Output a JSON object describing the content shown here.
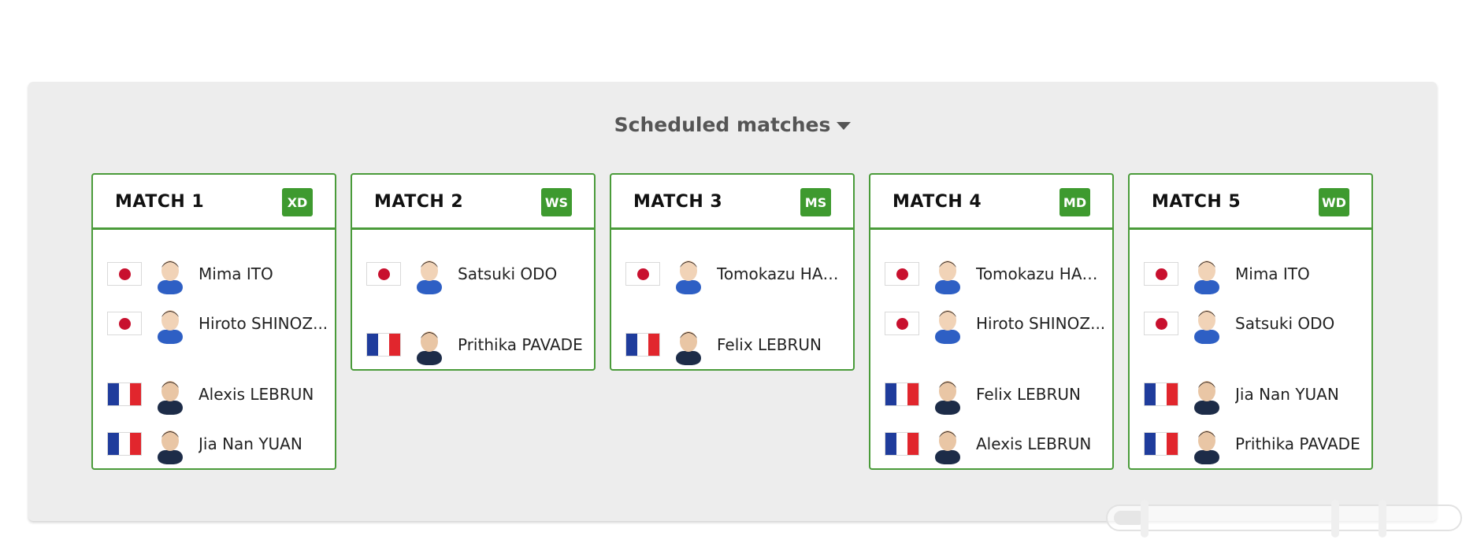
{
  "section": {
    "title": "Scheduled matches"
  },
  "flags": {
    "jp": "japan-flag",
    "fr": "france-flag"
  },
  "colors": {
    "accent_green": "#3e9a2f",
    "card_border": "#4a9b3a",
    "panel_bg": "#ededed"
  },
  "matches": [
    {
      "title": "MATCH 1",
      "badge": "XD",
      "players": [
        {
          "name": "Mima ITO",
          "country": "jp"
        },
        {
          "name": "Hiroto SHINOZ...",
          "country": "jp"
        },
        {
          "name": "Alexis LEBRUN",
          "country": "fr"
        },
        {
          "name": "Jia Nan YUAN",
          "country": "fr"
        }
      ]
    },
    {
      "title": "MATCH 2",
      "badge": "WS",
      "players": [
        {
          "name": "Satsuki ODO",
          "country": "jp"
        },
        {
          "name": "Prithika PAVADE",
          "country": "fr"
        }
      ]
    },
    {
      "title": "MATCH 3",
      "badge": "MS",
      "players": [
        {
          "name": "Tomokazu HARI...",
          "country": "jp"
        },
        {
          "name": "Felix LEBRUN",
          "country": "fr"
        }
      ]
    },
    {
      "title": "MATCH 4",
      "badge": "MD",
      "players": [
        {
          "name": "Tomokazu HARI...",
          "country": "jp"
        },
        {
          "name": "Hiroto SHINOZ...",
          "country": "jp"
        },
        {
          "name": "Felix LEBRUN",
          "country": "fr"
        },
        {
          "name": "Alexis LEBRUN",
          "country": "fr"
        }
      ]
    },
    {
      "title": "MATCH 5",
      "badge": "WD",
      "players": [
        {
          "name": "Mima ITO",
          "country": "jp"
        },
        {
          "name": "Satsuki ODO",
          "country": "jp"
        },
        {
          "name": "Jia Nan YUAN",
          "country": "fr"
        },
        {
          "name": "Prithika PAVADE",
          "country": "fr"
        }
      ]
    }
  ]
}
